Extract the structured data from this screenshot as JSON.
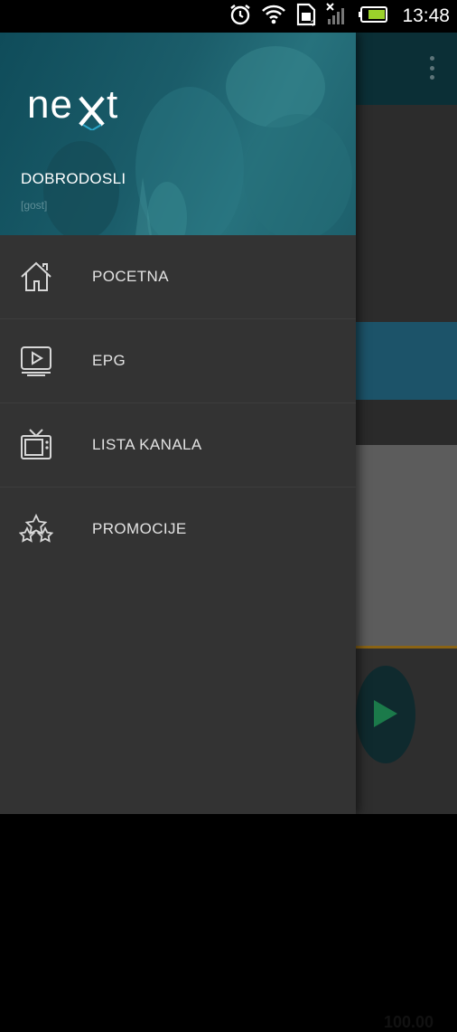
{
  "status_bar": {
    "time": "13:48",
    "icons": [
      "alarm-icon",
      "wifi-icon",
      "sim-card-icon",
      "signal-icon",
      "battery-icon"
    ]
  },
  "drawer": {
    "brand": "next",
    "welcome": "DOBRODOSLI",
    "username": "[gost]",
    "menu": [
      {
        "label": "POCETNA",
        "icon": "home-icon"
      },
      {
        "label": "EPG",
        "icon": "epg-play-icon"
      },
      {
        "label": "LISTA KANALA",
        "icon": "tv-icon"
      },
      {
        "label": "PROMOCIJE",
        "icon": "stars-icon"
      }
    ]
  },
  "background_app": {
    "price": "100.00"
  },
  "colors": {
    "drawer_bg": "#333333",
    "header_teal": "#1b5d6a",
    "banner_blue": "#1c5369",
    "accent_green": "#1b7a4a",
    "accent_orange": "#8a6314"
  }
}
